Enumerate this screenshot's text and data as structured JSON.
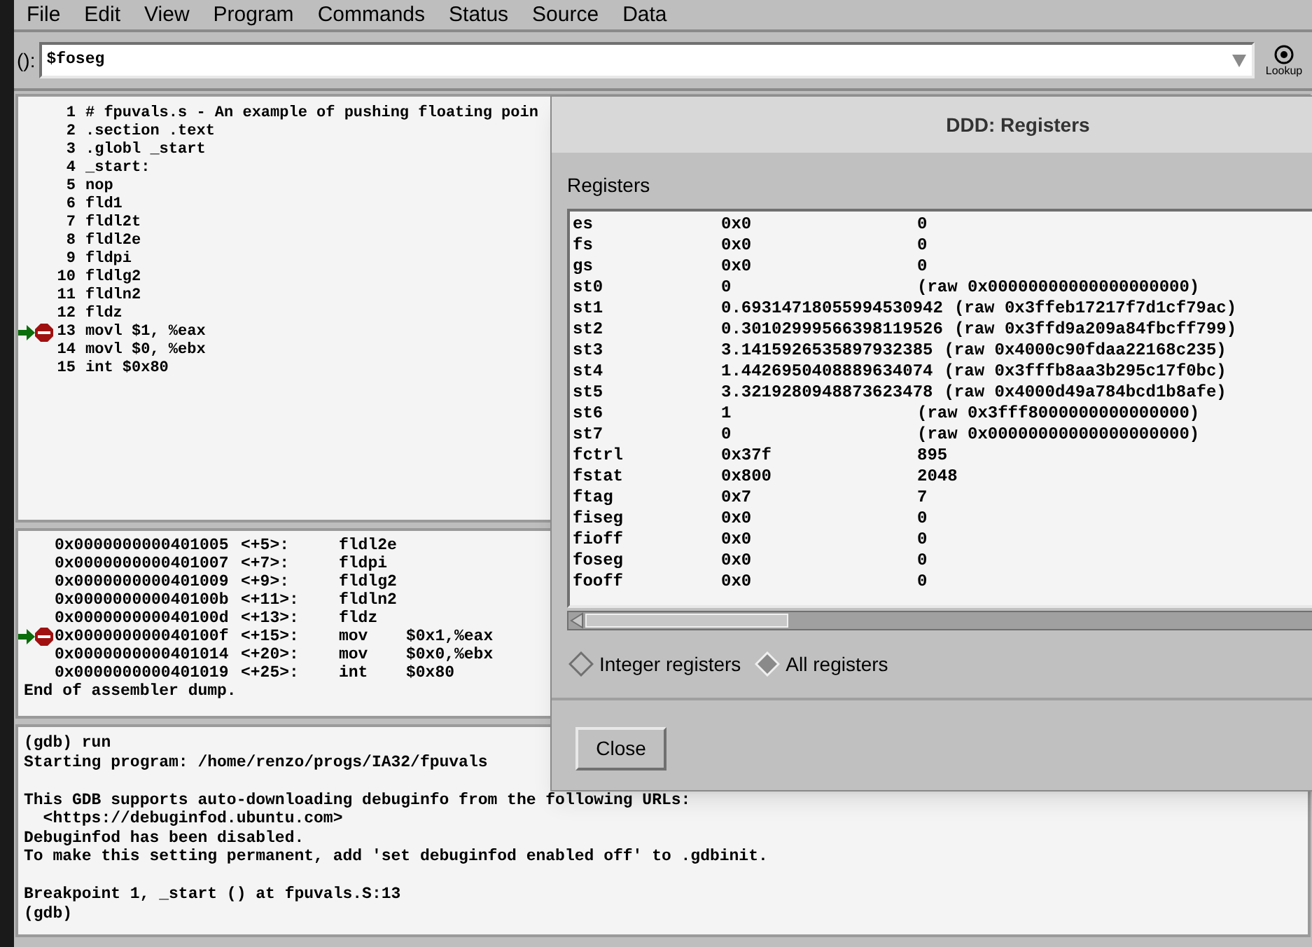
{
  "menu": [
    "File",
    "Edit",
    "View",
    "Program",
    "Commands",
    "Status",
    "Source",
    "Data"
  ],
  "argument": {
    "label": "():",
    "value": "$foseg"
  },
  "lookup_button": "Lookup",
  "source": {
    "lines": [
      {
        "number": "1",
        "text": "# fpuvals.s - An example of pushing floating poin",
        "current": false,
        "breakpoint": false
      },
      {
        "number": "2",
        "text": ".section .text",
        "current": false,
        "breakpoint": false
      },
      {
        "number": "3",
        "text": ".globl _start",
        "current": false,
        "breakpoint": false
      },
      {
        "number": "4",
        "text": "_start:",
        "current": false,
        "breakpoint": false
      },
      {
        "number": "5",
        "text": "nop",
        "current": false,
        "breakpoint": false
      },
      {
        "number": "6",
        "text": "fld1",
        "current": false,
        "breakpoint": false
      },
      {
        "number": "7",
        "text": "fldl2t",
        "current": false,
        "breakpoint": false
      },
      {
        "number": "8",
        "text": "fldl2e",
        "current": false,
        "breakpoint": false
      },
      {
        "number": "9",
        "text": "fldpi",
        "current": false,
        "breakpoint": false
      },
      {
        "number": "10",
        "text": "fldlg2",
        "current": false,
        "breakpoint": false
      },
      {
        "number": "11",
        "text": "fldln2",
        "current": false,
        "breakpoint": false
      },
      {
        "number": "12",
        "text": "fldz",
        "current": false,
        "breakpoint": false
      },
      {
        "number": "13",
        "text": "movl $1, %eax",
        "current": true,
        "breakpoint": true
      },
      {
        "number": "14",
        "text": "movl $0, %ebx",
        "current": false,
        "breakpoint": false
      },
      {
        "number": "15",
        "text": "int $0x80",
        "current": false,
        "breakpoint": false
      }
    ]
  },
  "disassembly": {
    "rows": [
      {
        "address": "0x0000000000401005",
        "offset": "<+5>:",
        "instruction": "fldl2e",
        "current": false,
        "breakpoint": false
      },
      {
        "address": "0x0000000000401007",
        "offset": "<+7>:",
        "instruction": "fldpi",
        "current": false,
        "breakpoint": false
      },
      {
        "address": "0x0000000000401009",
        "offset": "<+9>:",
        "instruction": "fldlg2",
        "current": false,
        "breakpoint": false
      },
      {
        "address": "0x000000000040100b",
        "offset": "<+11>:",
        "instruction": "fldln2",
        "current": false,
        "breakpoint": false
      },
      {
        "address": "0x000000000040100d",
        "offset": "<+13>:",
        "instruction": "fldz",
        "current": false,
        "breakpoint": false
      },
      {
        "address": "0x000000000040100f",
        "offset": "<+15>:",
        "instruction": "mov",
        "operands": "$0x1,%eax",
        "current": true,
        "breakpoint": true
      },
      {
        "address": "0x0000000000401014",
        "offset": "<+20>:",
        "instruction": "mov",
        "operands": "$0x0,%ebx",
        "current": false,
        "breakpoint": false
      },
      {
        "address": "0x0000000000401019",
        "offset": "<+25>:",
        "instruction": "int",
        "operands": "$0x80",
        "current": false,
        "breakpoint": false
      }
    ],
    "footer": "End of assembler dump."
  },
  "console": {
    "paragraphs": [
      [
        "(gdb) run",
        "Starting program: /home/renzo/progs/IA32/fpuvals"
      ],
      [
        "This GDB supports auto-downloading debuginfo from the following URLs:",
        "  <https://debuginfod.ubuntu.com>",
        "Debuginfod has been disabled.",
        "To make this setting permanent, add 'set debuginfod enabled off' to .gdbinit."
      ],
      [
        "Breakpoint 1, _start () at fpuvals.S:13",
        "(gdb)"
      ]
    ]
  },
  "registers_dialog": {
    "title": "DDD: Registers",
    "list_label": "Registers",
    "rows": [
      {
        "name": "es",
        "value": "0x0",
        "natural": "0"
      },
      {
        "name": "fs",
        "value": "0x0",
        "natural": "0"
      },
      {
        "name": "gs",
        "value": "0x0",
        "natural": "0"
      },
      {
        "name": "st0",
        "value": "0",
        "natural": "(raw 0x00000000000000000000)"
      },
      {
        "name": "st1",
        "value": "0.69314718055994530942",
        "natural": "(raw 0x3ffeb17217f7d1cf79ac)"
      },
      {
        "name": "st2",
        "value": "0.30102999566398119526",
        "natural": "(raw 0x3ffd9a209a84fbcff799)"
      },
      {
        "name": "st3",
        "value": "3.1415926535897932385",
        "natural": "(raw 0x4000c90fdaa22168c235)"
      },
      {
        "name": "st4",
        "value": "1.4426950408889634074",
        "natural": "(raw 0x3fffb8aa3b295c17f0bc)"
      },
      {
        "name": "st5",
        "value": "3.3219280948873623478",
        "natural": "(raw 0x4000d49a784bcd1b8afe)"
      },
      {
        "name": "st6",
        "value": "1",
        "natural": "(raw 0x3fff8000000000000000)"
      },
      {
        "name": "st7",
        "value": "0",
        "natural": "(raw 0x00000000000000000000)"
      },
      {
        "name": "fctrl",
        "value": "0x37f",
        "natural": "895"
      },
      {
        "name": "fstat",
        "value": "0x800",
        "natural": "2048"
      },
      {
        "name": "ftag",
        "value": "0x7",
        "natural": "7"
      },
      {
        "name": "fiseg",
        "value": "0x0",
        "natural": "0"
      },
      {
        "name": "fioff",
        "value": "0x0",
        "natural": "0"
      },
      {
        "name": "foseg",
        "value": "0x0",
        "natural": "0"
      },
      {
        "name": "fooff",
        "value": "0x0",
        "natural": "0"
      }
    ],
    "options": [
      {
        "label": "Integer registers",
        "selected": false
      },
      {
        "label": "All registers",
        "selected": true
      }
    ],
    "close_button": "Close"
  }
}
